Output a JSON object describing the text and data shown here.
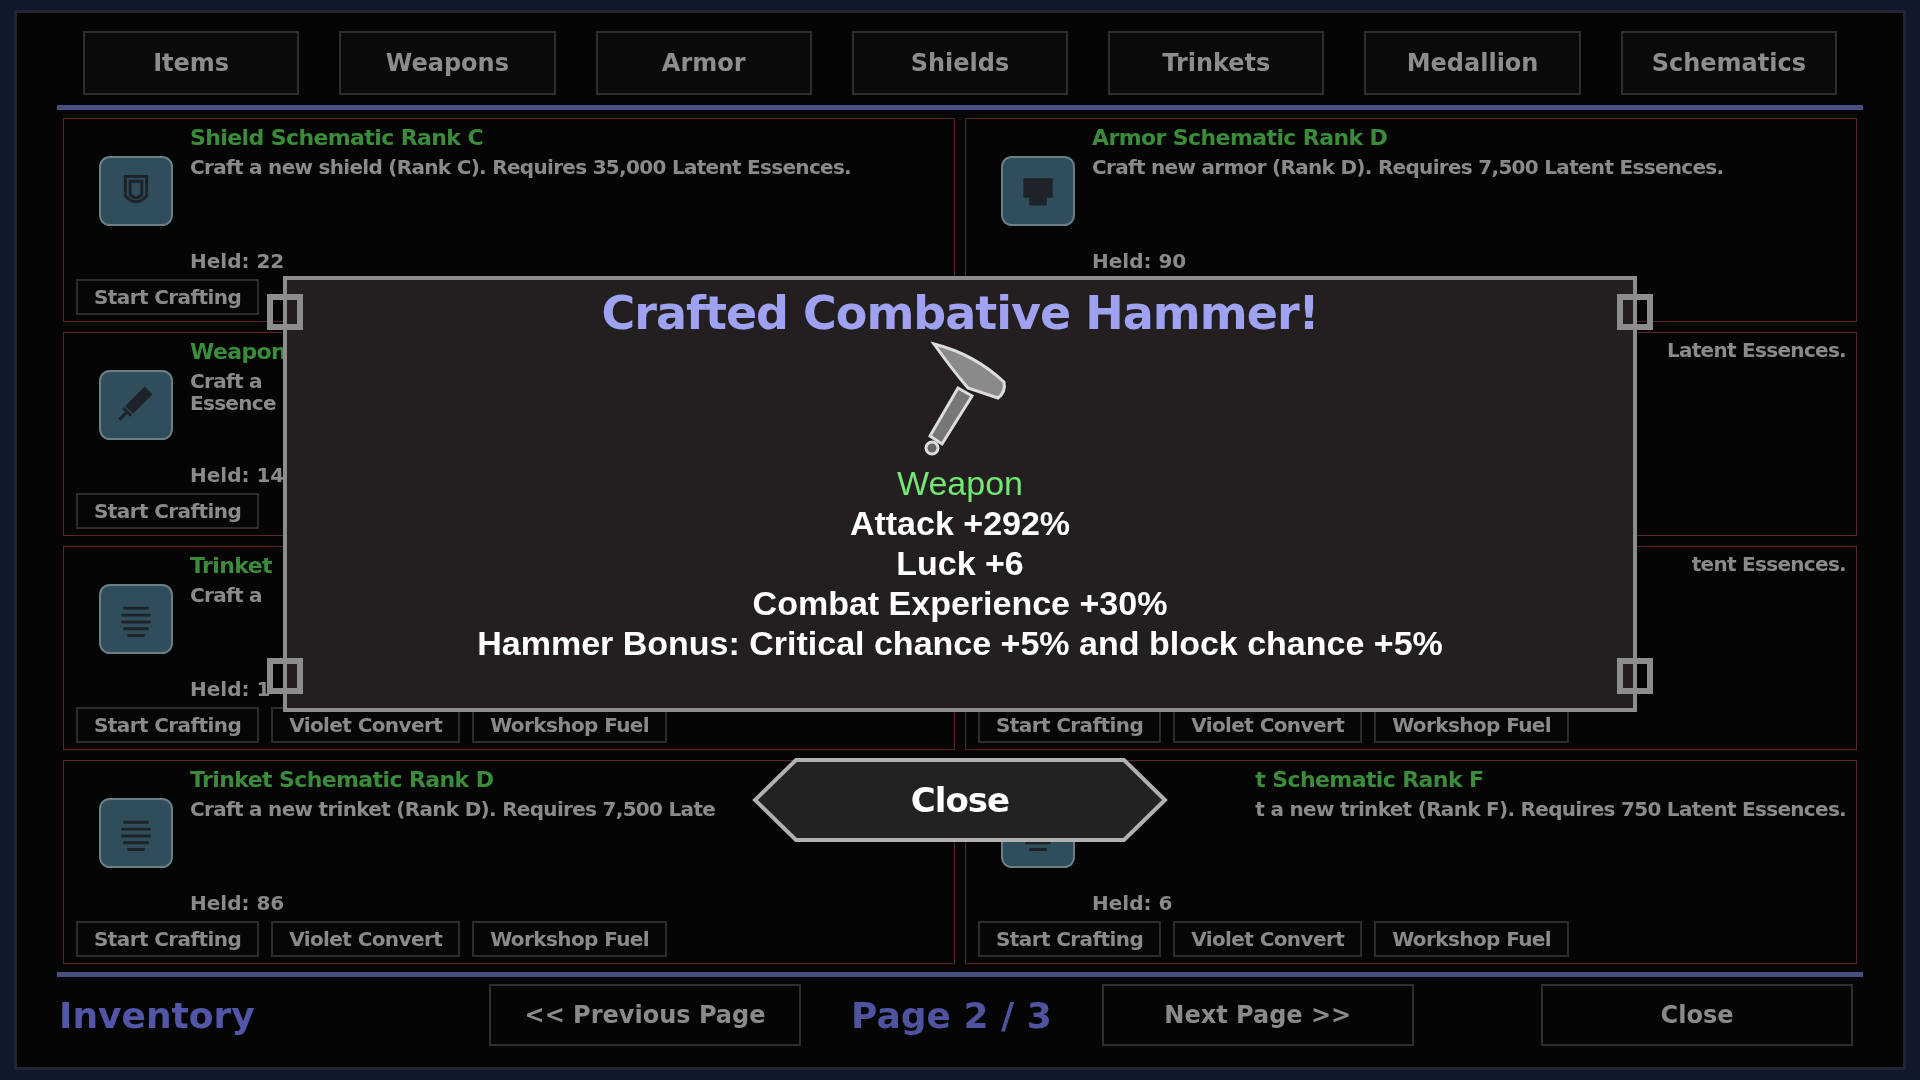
{
  "tabs": [
    {
      "label": "Items"
    },
    {
      "label": "Weapons"
    },
    {
      "label": "Armor"
    },
    {
      "label": "Shields"
    },
    {
      "label": "Trinkets"
    },
    {
      "label": "Medallion"
    },
    {
      "label": "Schematics"
    }
  ],
  "cards": [
    {
      "kind": "shield",
      "title": "Shield Schematic Rank C",
      "description_lines": [
        "Craft a new shield (Rank C). Requires 35,000 Latent Essences."
      ],
      "held": "Held: 22",
      "actions": [
        "Start Crafting"
      ]
    },
    {
      "kind": "armor",
      "title": "Armor Schematic Rank D",
      "description_lines": [
        "Craft new armor (Rank D). Requires 7,500 Latent Essences."
      ],
      "held": "Held: 90"
    },
    {
      "kind": "weapon",
      "title": "Weapon",
      "description_lines": [
        "Craft a",
        "Essence"
      ],
      "held": "Held: 14",
      "actions": [
        "Start Crafting"
      ]
    },
    {
      "cut_left": true,
      "description_lines": [
        "Latent Essences."
      ]
    },
    {
      "kind": "trinket",
      "title": "Trinket",
      "description_lines": [
        "Craft a"
      ],
      "held": "Held: 1",
      "actions": [
        "Start Crafting",
        "Violet Convert",
        "Workshop Fuel"
      ]
    },
    {
      "cut_left": true,
      "description_lines": [
        "tent Essences."
      ],
      "actions": [
        "Start Crafting",
        "Violet Convert",
        "Workshop Fuel"
      ]
    },
    {
      "kind": "trinket",
      "title": "Trinket Schematic Rank D",
      "description_lines": [
        "Craft a new trinket (Rank D). Requires 7,500 Late"
      ],
      "held": "Held: 86",
      "actions": [
        "Start Crafting",
        "Violet Convert",
        "Workshop Fuel"
      ]
    },
    {
      "kind": "trinket",
      "cut_left": true,
      "title": "t Schematic Rank F",
      "description_lines": [
        "t a new trinket (Rank F). Requires 750 Latent Essences."
      ],
      "held": "Held: 6",
      "actions": [
        "Start Crafting",
        "Violet Convert",
        "Workshop Fuel"
      ]
    }
  ],
  "footer": {
    "title": "Inventory",
    "previous": "<< Previous Page",
    "page": "Page 2 / 3",
    "next": "Next Page >>",
    "close": "Close"
  },
  "modal": {
    "title": "Crafted Combative Hammer!",
    "item_type": "Weapon",
    "stats": [
      "Attack +292%",
      "Luck +6",
      "Combat Experience +30%",
      "Hammer Bonus: Critical chance +5% and block chance +5%"
    ],
    "button": "Close"
  }
}
